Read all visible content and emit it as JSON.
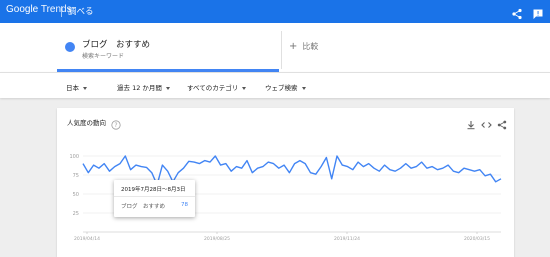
{
  "header": {
    "brand": "Google Trends",
    "brand_google": "Google",
    "brand_trends": "Trends",
    "title": "調べる",
    "share_icon": "share-icon",
    "feedback_icon": "feedback-icon",
    "bg_color": "#1a73e8"
  },
  "comparison": {
    "term": "ブログ　おすすめ",
    "term_type": "検索キーワード",
    "term_color": "#4285f4",
    "compare_label": "比較"
  },
  "filters": {
    "region": "日本",
    "period": "過去 12 か月間",
    "category": "すべてのカテゴリ",
    "property": "ウェブ検索"
  },
  "card": {
    "title": "人気度の動向",
    "help_icon": "help-icon",
    "download_icon": "download-icon",
    "embed_icon": "embed-icon",
    "share_icon": "share-icon"
  },
  "tooltip": {
    "date": "2019年7月28日～8月3日",
    "term": "ブログ　おすすめ",
    "value": "78"
  },
  "chart_data": {
    "type": "line",
    "ylim": [
      0,
      100
    ],
    "y_ticks": [
      "100",
      "75",
      "50",
      "25"
    ],
    "x_ticks": [
      "2019/04/14",
      "2019/08/25",
      "2019/11/24",
      "2020/03/15"
    ],
    "series": [
      {
        "name": "ブログ　おすすめ",
        "color": "#4285f4",
        "values": [
          90,
          78,
          88,
          84,
          90,
          80,
          86,
          90,
          100,
          82,
          88,
          86,
          85,
          78,
          62,
          88,
          80,
          66,
          78,
          84,
          93,
          92,
          90,
          94,
          92,
          100,
          88,
          90,
          80,
          86,
          84,
          94,
          78,
          84,
          86,
          92,
          90,
          84,
          88,
          78,
          90,
          94,
          90,
          78,
          76,
          86,
          98,
          70,
          100,
          88,
          86,
          82,
          92,
          86,
          90,
          84,
          80,
          88,
          82,
          80,
          84,
          90,
          84,
          86,
          92,
          84,
          86,
          82,
          84,
          88,
          80,
          78,
          84,
          82,
          80,
          82,
          74,
          76,
          66,
          70
        ]
      }
    ]
  }
}
